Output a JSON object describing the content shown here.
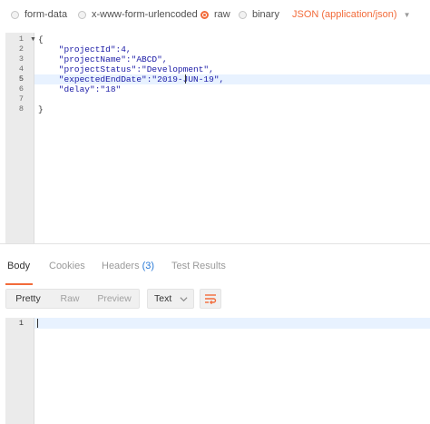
{
  "body_types": [
    {
      "label": "form-data",
      "selected": false
    },
    {
      "label": "x-www-form-urlencoded",
      "selected": false
    },
    {
      "label": "raw",
      "selected": true
    },
    {
      "label": "binary",
      "selected": false
    }
  ],
  "content_type": {
    "label": "JSON (application/json)",
    "icon": "chevron-down-icon"
  },
  "request_editor": {
    "line_numbers": [
      "1",
      "2",
      "3",
      "4",
      "5",
      "6",
      "7",
      "8"
    ],
    "active_line": "5",
    "lines": [
      "{",
      "    \"projectId\":4,",
      "    \"projectName\":\"ABCD\",",
      "    \"projectStatus\":\"Development\",",
      "    \"expectedEndDate\":\"2019-JUN-19\",",
      "    \"delay\":\"18\"",
      "",
      "}"
    ]
  },
  "response_tabs": [
    {
      "label": "Body",
      "active": true
    },
    {
      "label": "Cookies",
      "active": false
    },
    {
      "label": "Headers",
      "count": "(3)",
      "active": false
    },
    {
      "label": "Test Results",
      "active": false
    }
  ],
  "view_modes": [
    {
      "label": "Pretty",
      "active": true
    },
    {
      "label": "Raw",
      "active": false
    },
    {
      "label": "Preview",
      "active": false
    }
  ],
  "format_select": {
    "value": "Text",
    "icon": "chevron-down-icon"
  },
  "wrap_button": {
    "icon": "wrap-lines-icon"
  },
  "response_editor": {
    "line_numbers": [
      "1"
    ],
    "lines": [
      ""
    ]
  },
  "colors": {
    "accent": "#f26b3a",
    "link": "#2a7ad6",
    "json": "#1a1aa6",
    "active_line": "#e8f2ff",
    "gutter": "#ebebeb"
  }
}
